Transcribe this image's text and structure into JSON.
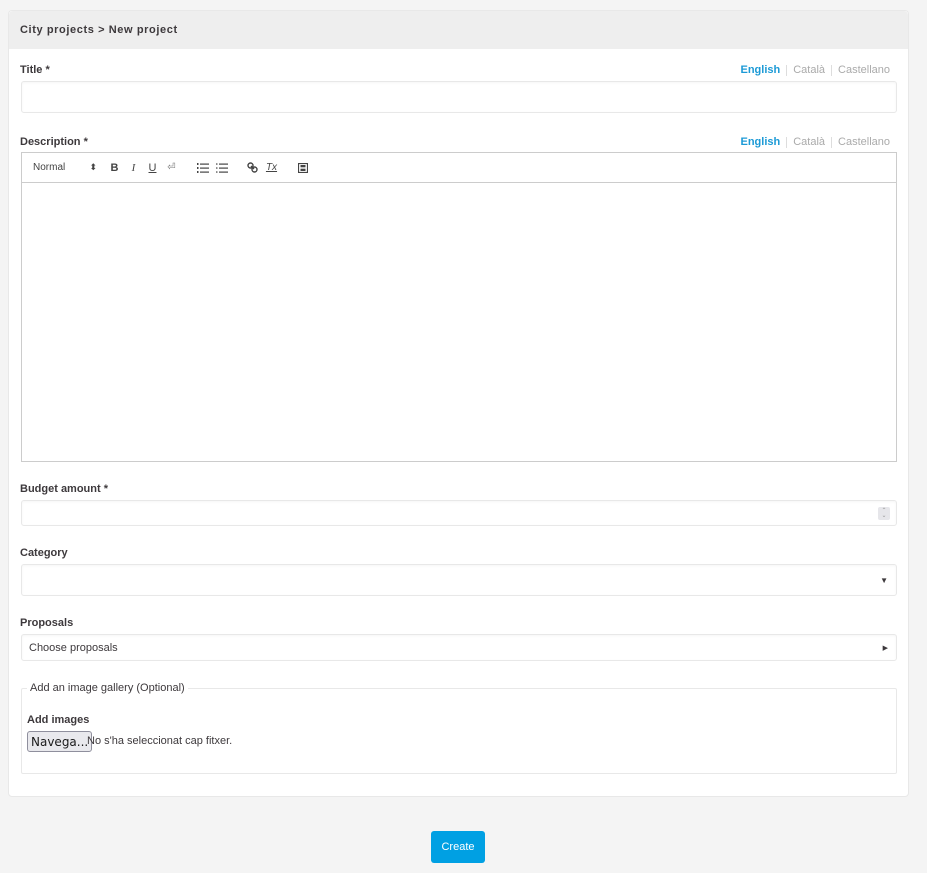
{
  "breadcrumb": {
    "parent": "City projects",
    "separator": ">",
    "current": "New project",
    "text": "City projects > New project"
  },
  "languages": [
    "English",
    "Català",
    "Castellano"
  ],
  "active_language": "English",
  "title_field": {
    "label": "Title *",
    "value": "",
    "languages": [
      {
        "label": "English",
        "active": true
      },
      {
        "label": "Català",
        "active": false
      },
      {
        "label": "Castellano",
        "active": false
      }
    ]
  },
  "description_field": {
    "label": "Description *",
    "value": "",
    "languages": [
      {
        "label": "English",
        "active": true
      },
      {
        "label": "Català",
        "active": false
      },
      {
        "label": "Castellano",
        "active": false
      }
    ],
    "toolbar": {
      "format_select": "Normal",
      "format_arrows": "⬍",
      "bold": "B",
      "italic": "I",
      "underline": "U",
      "linebreak": "⏎",
      "ordered_list": "☰",
      "bullet_list": "☰",
      "link": "🔗",
      "clean": "Tx",
      "video": "▣"
    }
  },
  "budget_field": {
    "label": "Budget amount *",
    "value": ""
  },
  "category_field": {
    "label": "Category",
    "selected": "",
    "arrow": "▼"
  },
  "proposals_field": {
    "label": "Proposals",
    "placeholder": "Choose proposals",
    "arrow": "▶"
  },
  "gallery": {
    "legend": "Add an image gallery (Optional)",
    "label": "Add images",
    "browse_button": "Navega...",
    "no_file_text": "No s'ha seleccionat cap fitxer."
  },
  "submit": {
    "label": "Create"
  },
  "colors": {
    "accent": "#1c9ad6",
    "button": "#00a0e3",
    "header_bg": "#eeeeee",
    "page_bg": "#f4f4f4"
  }
}
